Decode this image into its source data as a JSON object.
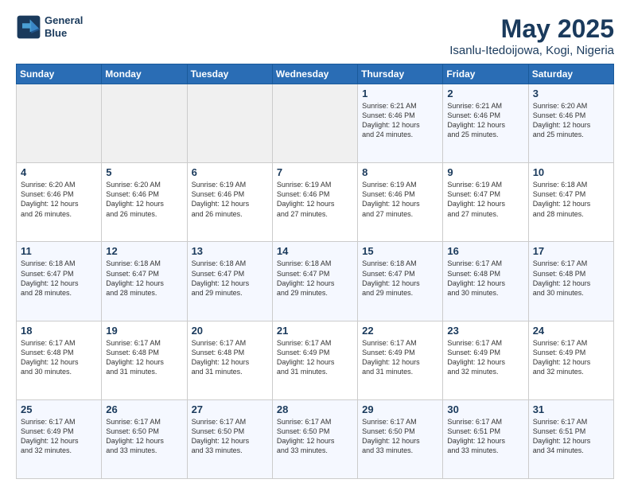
{
  "header": {
    "logo_line1": "General",
    "logo_line2": "Blue",
    "month": "May 2025",
    "location": "Isanlu-Itedoijowa, Kogi, Nigeria"
  },
  "days_of_week": [
    "Sunday",
    "Monday",
    "Tuesday",
    "Wednesday",
    "Thursday",
    "Friday",
    "Saturday"
  ],
  "weeks": [
    [
      {
        "day": "",
        "info": ""
      },
      {
        "day": "",
        "info": ""
      },
      {
        "day": "",
        "info": ""
      },
      {
        "day": "",
        "info": ""
      },
      {
        "day": "1",
        "info": "Sunrise: 6:21 AM\nSunset: 6:46 PM\nDaylight: 12 hours\nand 24 minutes."
      },
      {
        "day": "2",
        "info": "Sunrise: 6:21 AM\nSunset: 6:46 PM\nDaylight: 12 hours\nand 25 minutes."
      },
      {
        "day": "3",
        "info": "Sunrise: 6:20 AM\nSunset: 6:46 PM\nDaylight: 12 hours\nand 25 minutes."
      }
    ],
    [
      {
        "day": "4",
        "info": "Sunrise: 6:20 AM\nSunset: 6:46 PM\nDaylight: 12 hours\nand 26 minutes."
      },
      {
        "day": "5",
        "info": "Sunrise: 6:20 AM\nSunset: 6:46 PM\nDaylight: 12 hours\nand 26 minutes."
      },
      {
        "day": "6",
        "info": "Sunrise: 6:19 AM\nSunset: 6:46 PM\nDaylight: 12 hours\nand 26 minutes."
      },
      {
        "day": "7",
        "info": "Sunrise: 6:19 AM\nSunset: 6:46 PM\nDaylight: 12 hours\nand 27 minutes."
      },
      {
        "day": "8",
        "info": "Sunrise: 6:19 AM\nSunset: 6:46 PM\nDaylight: 12 hours\nand 27 minutes."
      },
      {
        "day": "9",
        "info": "Sunrise: 6:19 AM\nSunset: 6:47 PM\nDaylight: 12 hours\nand 27 minutes."
      },
      {
        "day": "10",
        "info": "Sunrise: 6:18 AM\nSunset: 6:47 PM\nDaylight: 12 hours\nand 28 minutes."
      }
    ],
    [
      {
        "day": "11",
        "info": "Sunrise: 6:18 AM\nSunset: 6:47 PM\nDaylight: 12 hours\nand 28 minutes."
      },
      {
        "day": "12",
        "info": "Sunrise: 6:18 AM\nSunset: 6:47 PM\nDaylight: 12 hours\nand 28 minutes."
      },
      {
        "day": "13",
        "info": "Sunrise: 6:18 AM\nSunset: 6:47 PM\nDaylight: 12 hours\nand 29 minutes."
      },
      {
        "day": "14",
        "info": "Sunrise: 6:18 AM\nSunset: 6:47 PM\nDaylight: 12 hours\nand 29 minutes."
      },
      {
        "day": "15",
        "info": "Sunrise: 6:18 AM\nSunset: 6:47 PM\nDaylight: 12 hours\nand 29 minutes."
      },
      {
        "day": "16",
        "info": "Sunrise: 6:17 AM\nSunset: 6:48 PM\nDaylight: 12 hours\nand 30 minutes."
      },
      {
        "day": "17",
        "info": "Sunrise: 6:17 AM\nSunset: 6:48 PM\nDaylight: 12 hours\nand 30 minutes."
      }
    ],
    [
      {
        "day": "18",
        "info": "Sunrise: 6:17 AM\nSunset: 6:48 PM\nDaylight: 12 hours\nand 30 minutes."
      },
      {
        "day": "19",
        "info": "Sunrise: 6:17 AM\nSunset: 6:48 PM\nDaylight: 12 hours\nand 31 minutes."
      },
      {
        "day": "20",
        "info": "Sunrise: 6:17 AM\nSunset: 6:48 PM\nDaylight: 12 hours\nand 31 minutes."
      },
      {
        "day": "21",
        "info": "Sunrise: 6:17 AM\nSunset: 6:49 PM\nDaylight: 12 hours\nand 31 minutes."
      },
      {
        "day": "22",
        "info": "Sunrise: 6:17 AM\nSunset: 6:49 PM\nDaylight: 12 hours\nand 31 minutes."
      },
      {
        "day": "23",
        "info": "Sunrise: 6:17 AM\nSunset: 6:49 PM\nDaylight: 12 hours\nand 32 minutes."
      },
      {
        "day": "24",
        "info": "Sunrise: 6:17 AM\nSunset: 6:49 PM\nDaylight: 12 hours\nand 32 minutes."
      }
    ],
    [
      {
        "day": "25",
        "info": "Sunrise: 6:17 AM\nSunset: 6:49 PM\nDaylight: 12 hours\nand 32 minutes."
      },
      {
        "day": "26",
        "info": "Sunrise: 6:17 AM\nSunset: 6:50 PM\nDaylight: 12 hours\nand 33 minutes."
      },
      {
        "day": "27",
        "info": "Sunrise: 6:17 AM\nSunset: 6:50 PM\nDaylight: 12 hours\nand 33 minutes."
      },
      {
        "day": "28",
        "info": "Sunrise: 6:17 AM\nSunset: 6:50 PM\nDaylight: 12 hours\nand 33 minutes."
      },
      {
        "day": "29",
        "info": "Sunrise: 6:17 AM\nSunset: 6:50 PM\nDaylight: 12 hours\nand 33 minutes."
      },
      {
        "day": "30",
        "info": "Sunrise: 6:17 AM\nSunset: 6:51 PM\nDaylight: 12 hours\nand 33 minutes."
      },
      {
        "day": "31",
        "info": "Sunrise: 6:17 AM\nSunset: 6:51 PM\nDaylight: 12 hours\nand 34 minutes."
      }
    ]
  ]
}
